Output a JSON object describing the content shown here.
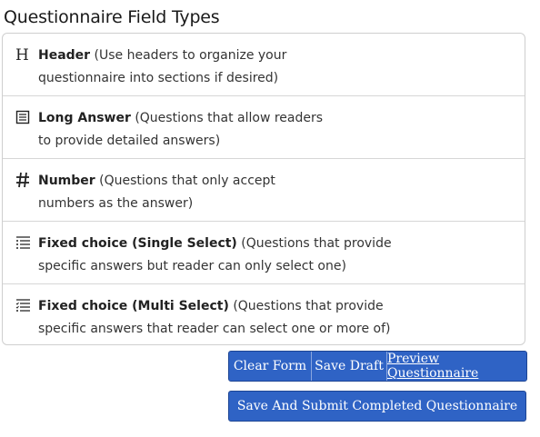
{
  "title": "Questionnaire Field Types",
  "field_types": [
    {
      "icon": "header-h-icon",
      "label": "Header",
      "description": "(Use headers to organize your",
      "description_line2": "questionnaire into sections if desired)"
    },
    {
      "icon": "long-answer-icon",
      "label": "Long Answer",
      "description": "(Questions that allow readers",
      "description_line2": "to provide detailed answers)"
    },
    {
      "icon": "hash-number-icon",
      "label": "Number",
      "description": "(Questions that only accept",
      "description_line2": "numbers as the answer)"
    },
    {
      "icon": "single-select-list-icon",
      "label": "Fixed choice (Single Select)",
      "description": "(Questions that provide",
      "description_line2": "specific answers but reader can only select one)"
    },
    {
      "icon": "multi-select-list-icon",
      "label": "Fixed choice (Multi Select)",
      "description": "(Questions that provide",
      "description_line2": "specific answers that reader can select one or more of)"
    }
  ],
  "buttons": {
    "clear_form": "Clear Form",
    "save_draft": "Save Draft",
    "preview": "Preview Questionnaire",
    "submit": "Save And Submit Completed Questionnaire"
  },
  "colors": {
    "button_bg": "#2f63c5",
    "button_border": "#1d4594",
    "panel_border": "#cfcfcf"
  }
}
